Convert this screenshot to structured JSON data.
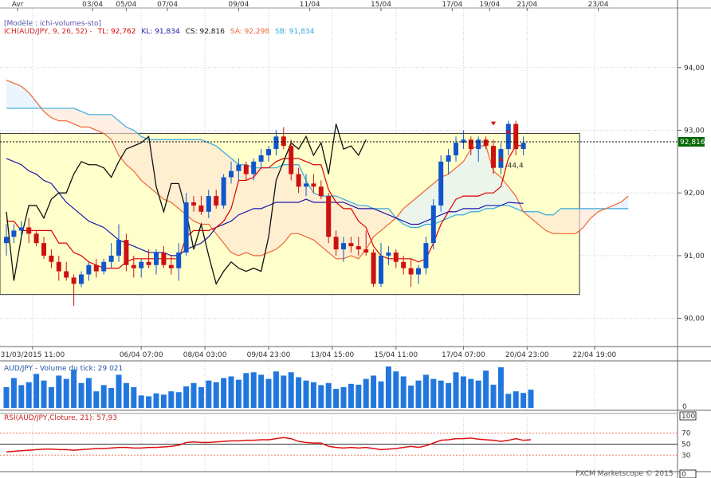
{
  "top_axis": {
    "ticks": [
      {
        "label": "Avr",
        "slot": 1.5
      },
      {
        "label": "03/04",
        "slot": 11.5
      },
      {
        "label": "05/04",
        "slot": 16
      },
      {
        "label": "07/04",
        "slot": 21.5
      },
      {
        "label": "09/04",
        "slot": 31
      },
      {
        "label": "11/04",
        "slot": 40.5
      },
      {
        "label": "15/04",
        "slot": 50
      },
      {
        "label": "17/04",
        "slot": 59.5
      },
      {
        "label": "19/04",
        "slot": 64.5
      },
      {
        "label": "21/04",
        "slot": 69.5
      },
      {
        "label": "23/04",
        "slot": 79
      }
    ]
  },
  "header": {
    "model": "[Modèle : ichi-volumes-sto]",
    "ich_label": "ICH(AUD/JPY, 9, 26, 52) -",
    "tl": "TL: 92,762",
    "kl": "KL: 91,834",
    "cs": "CS: 92,816",
    "sa": "SA: 92,298",
    "sb": "SB: 91,834",
    "colors": {
      "ich": "#d02020",
      "tl": "#dd0000",
      "kl": "#1a1aaa",
      "cs": "#111111",
      "sa": "#ee6633",
      "sb": "#33aadd"
    }
  },
  "bottom_axis": {
    "ticks": [
      {
        "label": "31/03/2015 11:00",
        "slot": 3.5
      },
      {
        "label": "06/04 07:00",
        "slot": 18
      },
      {
        "label": "08/04 03:00",
        "slot": 26.5
      },
      {
        "label": "09/04 23:00",
        "slot": 35
      },
      {
        "label": "13/04 15:00",
        "slot": 43.5
      },
      {
        "label": "15/04 11:00",
        "slot": 52
      },
      {
        "label": "17/04 07:00",
        "slot": 61
      },
      {
        "label": "20/04 23:00",
        "slot": 69.5
      },
      {
        "label": "22/04 19:00",
        "slot": 78.5
      }
    ]
  },
  "volume_panel": {
    "title": "AUD/JPY - Volume du tick: 29 021",
    "axis_label": "0",
    "color": "#2277dd"
  },
  "rsi_panel": {
    "title": "RSI(AUD/JPY,Cloture, 21): 57,93",
    "axis_labels": [
      "100",
      "70",
      "50",
      "30",
      "0"
    ],
    "line_color": "#dd1111"
  },
  "watermark": "FXCM Marketscope © 2015",
  "chart_data": {
    "type": "candlestick",
    "instrument": "AUD/JPY",
    "y_ticks": [
      "94,00",
      "93,00",
      "92,00",
      "91,00",
      "90,00"
    ],
    "ylim": [
      89.55,
      94.95
    ],
    "last_price_label": "92,816",
    "last_price": 92.816,
    "annotation": "-44,4",
    "range_box": {
      "y_high": 92.95,
      "y_low": 90.38,
      "slot_end": 76.5
    },
    "candles": [
      {
        "o": 91.2,
        "h": 91.5,
        "l": 91.0,
        "c": 91.3
      },
      {
        "o": 91.3,
        "h": 91.5,
        "l": 91.2,
        "c": 91.4
      },
      {
        "o": 91.4,
        "h": 91.55,
        "l": 91.3,
        "c": 91.45
      },
      {
        "o": 91.45,
        "h": 91.6,
        "l": 91.2,
        "c": 91.35
      },
      {
        "o": 91.35,
        "h": 91.4,
        "l": 91.15,
        "c": 91.2
      },
      {
        "o": 91.2,
        "h": 91.3,
        "l": 90.95,
        "c": 91.0
      },
      {
        "o": 91.0,
        "h": 91.1,
        "l": 90.8,
        "c": 90.9
      },
      {
        "o": 90.9,
        "h": 91.0,
        "l": 90.6,
        "c": 90.75
      },
      {
        "o": 90.75,
        "h": 90.9,
        "l": 90.6,
        "c": 90.65
      },
      {
        "o": 90.65,
        "h": 90.7,
        "l": 90.2,
        "c": 90.55
      },
      {
        "o": 90.55,
        "h": 90.75,
        "l": 90.5,
        "c": 90.7
      },
      {
        "o": 90.7,
        "h": 90.9,
        "l": 90.6,
        "c": 90.85
      },
      {
        "o": 90.85,
        "h": 90.95,
        "l": 90.65,
        "c": 90.75
      },
      {
        "o": 90.75,
        "h": 90.95,
        "l": 90.7,
        "c": 90.9
      },
      {
        "o": 90.9,
        "h": 91.2,
        "l": 90.8,
        "c": 91.0
      },
      {
        "o": 91.0,
        "h": 91.5,
        "l": 90.9,
        "c": 91.25
      },
      {
        "o": 91.25,
        "h": 91.35,
        "l": 90.75,
        "c": 90.85
      },
      {
        "o": 90.85,
        "h": 91.0,
        "l": 90.65,
        "c": 90.8
      },
      {
        "o": 90.8,
        "h": 90.95,
        "l": 90.65,
        "c": 90.9
      },
      {
        "o": 90.9,
        "h": 91.1,
        "l": 90.8,
        "c": 90.85
      },
      {
        "o": 90.85,
        "h": 91.1,
        "l": 90.7,
        "c": 91.05
      },
      {
        "o": 91.05,
        "h": 91.15,
        "l": 90.8,
        "c": 90.85
      },
      {
        "o": 90.85,
        "h": 91.0,
        "l": 90.7,
        "c": 90.8
      },
      {
        "o": 90.8,
        "h": 91.2,
        "l": 90.6,
        "c": 91.05
      },
      {
        "o": 91.05,
        "h": 92.0,
        "l": 91.0,
        "c": 91.85
      },
      {
        "o": 91.85,
        "h": 91.95,
        "l": 91.7,
        "c": 91.8
      },
      {
        "o": 91.8,
        "h": 91.95,
        "l": 91.65,
        "c": 91.7
      },
      {
        "o": 91.7,
        "h": 92.05,
        "l": 91.6,
        "c": 91.95
      },
      {
        "o": 91.95,
        "h": 92.05,
        "l": 91.75,
        "c": 91.8
      },
      {
        "o": 91.8,
        "h": 92.3,
        "l": 91.75,
        "c": 92.25
      },
      {
        "o": 92.25,
        "h": 92.5,
        "l": 92.15,
        "c": 92.35
      },
      {
        "o": 92.35,
        "h": 92.55,
        "l": 92.2,
        "c": 92.45
      },
      {
        "o": 92.45,
        "h": 92.5,
        "l": 92.2,
        "c": 92.3
      },
      {
        "o": 92.3,
        "h": 92.55,
        "l": 92.2,
        "c": 92.5
      },
      {
        "o": 92.5,
        "h": 92.7,
        "l": 92.4,
        "c": 92.6
      },
      {
        "o": 92.6,
        "h": 92.75,
        "l": 92.5,
        "c": 92.7
      },
      {
        "o": 92.7,
        "h": 93.0,
        "l": 92.6,
        "c": 92.9
      },
      {
        "o": 92.9,
        "h": 93.05,
        "l": 92.7,
        "c": 92.75
      },
      {
        "o": 92.75,
        "h": 92.85,
        "l": 92.2,
        "c": 92.3
      },
      {
        "o": 92.3,
        "h": 92.4,
        "l": 92.0,
        "c": 92.1
      },
      {
        "o": 92.1,
        "h": 92.3,
        "l": 91.95,
        "c": 92.15
      },
      {
        "o": 92.15,
        "h": 92.3,
        "l": 92.0,
        "c": 92.1
      },
      {
        "o": 92.1,
        "h": 92.2,
        "l": 91.9,
        "c": 91.95
      },
      {
        "o": 91.95,
        "h": 92.0,
        "l": 91.2,
        "c": 91.3
      },
      {
        "o": 91.3,
        "h": 91.4,
        "l": 91.0,
        "c": 91.1
      },
      {
        "o": 91.1,
        "h": 91.3,
        "l": 90.9,
        "c": 91.2
      },
      {
        "o": 91.2,
        "h": 91.3,
        "l": 91.05,
        "c": 91.15
      },
      {
        "o": 91.15,
        "h": 91.3,
        "l": 91.0,
        "c": 91.1
      },
      {
        "o": 91.1,
        "h": 91.4,
        "l": 91.0,
        "c": 91.05
      },
      {
        "o": 91.05,
        "h": 91.1,
        "l": 90.5,
        "c": 90.55
      },
      {
        "o": 90.55,
        "h": 91.2,
        "l": 90.5,
        "c": 91.0
      },
      {
        "o": 91.0,
        "h": 91.15,
        "l": 90.85,
        "c": 91.05
      },
      {
        "o": 91.05,
        "h": 91.1,
        "l": 90.8,
        "c": 90.9
      },
      {
        "o": 90.9,
        "h": 91.0,
        "l": 90.7,
        "c": 90.8
      },
      {
        "o": 90.8,
        "h": 90.95,
        "l": 90.5,
        "c": 90.7
      },
      {
        "o": 90.7,
        "h": 90.85,
        "l": 90.55,
        "c": 90.8
      },
      {
        "o": 90.8,
        "h": 91.3,
        "l": 90.7,
        "c": 91.2
      },
      {
        "o": 91.2,
        "h": 91.9,
        "l": 91.1,
        "c": 91.8
      },
      {
        "o": 91.8,
        "h": 92.6,
        "l": 91.7,
        "c": 92.5
      },
      {
        "o": 92.5,
        "h": 92.7,
        "l": 92.3,
        "c": 92.6
      },
      {
        "o": 92.6,
        "h": 92.9,
        "l": 92.5,
        "c": 92.8
      },
      {
        "o": 92.8,
        "h": 93.0,
        "l": 92.7,
        "c": 92.85
      },
      {
        "o": 92.85,
        "h": 92.9,
        "l": 92.6,
        "c": 92.7
      },
      {
        "o": 92.7,
        "h": 92.9,
        "l": 92.5,
        "c": 92.85
      },
      {
        "o": 92.85,
        "h": 92.9,
        "l": 92.7,
        "c": 92.75
      },
      {
        "o": 92.75,
        "h": 92.85,
        "l": 92.3,
        "c": 92.4
      },
      {
        "o": 92.4,
        "h": 92.8,
        "l": 92.3,
        "c": 92.7
      },
      {
        "o": 92.7,
        "h": 93.15,
        "l": 92.6,
        "c": 93.1
      },
      {
        "o": 93.1,
        "h": 93.15,
        "l": 92.6,
        "c": 92.7
      },
      {
        "o": 92.7,
        "h": 92.9,
        "l": 92.6,
        "c": 92.8
      }
    ],
    "series": [
      {
        "name": "TL",
        "color": "#dd0000",
        "values": [
          91.55,
          91.55,
          91.4,
          91.4,
          91.4,
          91.4,
          91.4,
          91.2,
          91.2,
          91.05,
          91.0,
          90.9,
          90.85,
          90.8,
          90.8,
          90.8,
          90.9,
          90.95,
          90.95,
          90.95,
          90.95,
          90.95,
          90.95,
          90.95,
          91.3,
          91.4,
          91.4,
          91.4,
          91.45,
          91.55,
          91.75,
          92.2,
          92.2,
          92.25,
          92.4,
          92.4,
          92.5,
          92.55,
          92.55,
          92.55,
          92.5,
          92.45,
          92.45,
          92.05,
          91.85,
          91.75,
          91.75,
          91.55,
          91.45,
          91.15,
          91.0,
          90.95,
          90.95,
          90.95,
          90.95,
          90.9,
          90.95,
          91.2,
          91.5,
          91.7,
          91.9,
          91.95,
          91.95,
          91.95,
          92.0,
          92.0,
          92.1,
          92.55,
          92.75,
          92.76
        ]
      },
      {
        "name": "KL",
        "color": "#1a1aaa",
        "values": [
          92.55,
          92.5,
          92.45,
          92.35,
          92.3,
          92.2,
          92.15,
          92.0,
          91.85,
          91.75,
          91.65,
          91.55,
          91.5,
          91.45,
          91.35,
          91.25,
          91.2,
          91.15,
          91.1,
          91.05,
          91.05,
          91.05,
          91.0,
          91.0,
          91.1,
          91.15,
          91.2,
          91.3,
          91.45,
          91.5,
          91.55,
          91.65,
          91.7,
          91.75,
          91.75,
          91.8,
          91.85,
          91.85,
          91.85,
          91.85,
          91.9,
          91.85,
          91.85,
          91.85,
          91.85,
          91.85,
          91.8,
          91.75,
          91.75,
          91.75,
          91.7,
          91.65,
          91.6,
          91.55,
          91.5,
          91.5,
          91.55,
          91.6,
          91.65,
          91.7,
          91.7,
          91.75,
          91.75,
          91.75,
          91.8,
          91.8,
          91.8,
          91.85,
          91.84,
          91.834
        ]
      },
      {
        "name": "CS",
        "color": "#111111",
        "values": [
          91.7,
          90.6,
          91.3,
          91.8,
          91.8,
          91.6,
          91.9,
          92.0,
          92.0,
          92.3,
          92.5,
          92.45,
          92.45,
          92.4,
          92.25,
          92.5,
          92.7,
          92.75,
          92.8,
          92.9,
          92.1,
          91.7,
          92.15,
          92.15,
          91.7,
          91.1,
          91.5,
          91.0,
          90.55,
          90.75,
          90.9,
          90.8,
          90.75,
          90.8,
          90.75,
          91.3,
          92.2,
          92.5,
          92.8,
          92.7,
          92.9,
          92.6,
          92.8,
          92.3,
          93.1,
          92.7,
          92.75,
          92.6,
          92.85
        ]
      },
      {
        "name": "SA",
        "color": "#ee6633",
        "values": [
          93.8,
          93.75,
          93.7,
          93.6,
          93.45,
          93.3,
          93.2,
          93.15,
          93.15,
          93.1,
          93.05,
          93.05,
          93.0,
          92.95,
          92.85,
          92.6,
          92.45,
          92.35,
          92.2,
          92.1,
          92.0,
          91.9,
          91.85,
          91.75,
          91.65,
          91.55,
          91.5,
          91.5,
          91.35,
          91.2,
          91.05,
          91.0,
          91.05,
          91.0,
          91.0,
          91.05,
          91.1,
          91.2,
          91.35,
          91.35,
          91.3,
          91.25,
          91.15,
          91.05,
          90.95,
          90.95,
          91.0,
          90.95,
          91.1,
          91.3,
          91.4,
          91.5,
          91.6,
          91.75,
          91.85,
          91.95,
          92.05,
          92.15,
          92.25,
          92.3,
          92.4,
          92.5,
          92.7,
          92.75,
          92.75,
          92.35,
          92.25,
          92.1,
          91.95,
          91.7,
          91.6,
          91.5,
          91.4,
          91.35,
          91.35,
          91.35,
          91.35,
          91.45,
          91.6,
          91.7,
          91.75,
          91.8,
          91.85,
          91.95
        ]
      },
      {
        "name": "SB",
        "color": "#33aadd",
        "values": [
          93.35,
          93.35,
          93.35,
          93.35,
          93.35,
          93.35,
          93.35,
          93.35,
          93.35,
          93.35,
          93.3,
          93.25,
          93.25,
          93.25,
          93.25,
          93.15,
          93.05,
          93.0,
          92.9,
          92.85,
          92.85,
          92.85,
          92.85,
          92.85,
          92.85,
          92.85,
          92.85,
          92.8,
          92.75,
          92.65,
          92.55,
          92.45,
          92.45,
          92.4,
          92.4,
          92.4,
          92.4,
          92.45,
          92.45,
          92.45,
          92.2,
          92.0,
          91.95,
          91.95,
          91.95,
          91.9,
          91.85,
          91.8,
          91.8,
          91.75,
          91.75,
          91.75,
          91.6,
          91.5,
          91.45,
          91.45,
          91.5,
          91.5,
          91.55,
          91.6,
          91.65,
          91.65,
          91.7,
          91.7,
          91.75,
          91.75,
          91.8,
          91.8,
          91.75,
          91.7,
          91.7,
          91.7,
          91.65,
          91.65,
          91.75,
          91.75,
          91.75,
          91.75,
          91.75,
          91.75,
          91.75,
          91.75,
          91.75,
          91.75
        ]
      }
    ],
    "volumes": [
      0.5,
      0.72,
      0.55,
      0.62,
      0.82,
      0.66,
      0.5,
      0.78,
      0.7,
      0.92,
      0.6,
      0.72,
      0.4,
      0.55,
      0.48,
      0.8,
      0.6,
      0.5,
      0.3,
      0.28,
      0.35,
      0.32,
      0.4,
      0.38,
      0.52,
      0.6,
      0.5,
      0.66,
      0.62,
      0.72,
      0.76,
      0.68,
      0.84,
      0.86,
      0.8,
      0.7,
      0.88,
      0.78,
      0.86,
      0.74,
      0.66,
      0.62,
      0.55,
      0.6,
      0.46,
      0.5,
      0.58,
      0.56,
      0.7,
      0.78,
      0.64,
      1.0,
      0.88,
      0.76,
      0.54,
      0.66,
      0.8,
      0.7,
      0.66,
      0.6,
      0.86,
      0.76,
      0.7,
      0.66,
      0.9,
      0.56,
      0.98,
      0.34,
      0.4,
      0.36,
      0.44
    ],
    "rsi": [
      36,
      37,
      38,
      39,
      40,
      41,
      41,
      40,
      40,
      39,
      40,
      41,
      42,
      42,
      43,
      44,
      44,
      43,
      43,
      44,
      44,
      45,
      46,
      48,
      53,
      54,
      53,
      53,
      54,
      55,
      56,
      56,
      57,
      57,
      58,
      58,
      60,
      62,
      60,
      55,
      53,
      52,
      52,
      46,
      44,
      43,
      44,
      43,
      44,
      42,
      40,
      41,
      42,
      44,
      46,
      44,
      47,
      52,
      57,
      58,
      60,
      60,
      61,
      59,
      58,
      57,
      55,
      57,
      60,
      57,
      58
    ],
    "rsi_levels": [
      100,
      70,
      50,
      30,
      0
    ]
  }
}
